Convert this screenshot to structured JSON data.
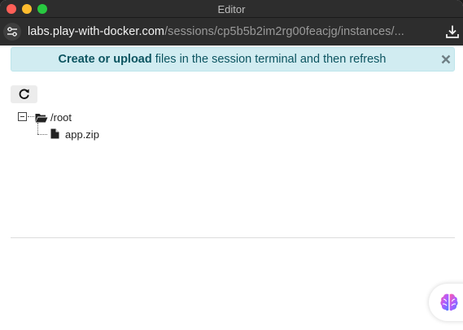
{
  "window": {
    "title": "Editor"
  },
  "address": {
    "host": "labs.play-with-docker.com",
    "path": "/sessions/cp5b5b2im2rg00feacjg/instances/..."
  },
  "alert": {
    "bold_text": "Create or upload",
    "text": " files in the session terminal and then refresh"
  },
  "tree": {
    "root": {
      "label": "/root",
      "expanded": true
    },
    "children": [
      {
        "label": "app.zip",
        "type": "file"
      }
    ]
  },
  "icons": {
    "titlebar": [
      "close-window",
      "minimize-window",
      "maximize-window"
    ],
    "address": [
      "site-settings-icon",
      "download-icon"
    ],
    "alert": "close-icon",
    "toolbar": "refresh-icon",
    "tree": [
      "collapse-toggle-icon",
      "folder-open-icon",
      "file-icon"
    ],
    "floating": "brain-icon"
  },
  "colors": {
    "alert_bg": "#d1ecf1",
    "alert_text": "#0c5460",
    "chrome": "#2d2d2d"
  }
}
